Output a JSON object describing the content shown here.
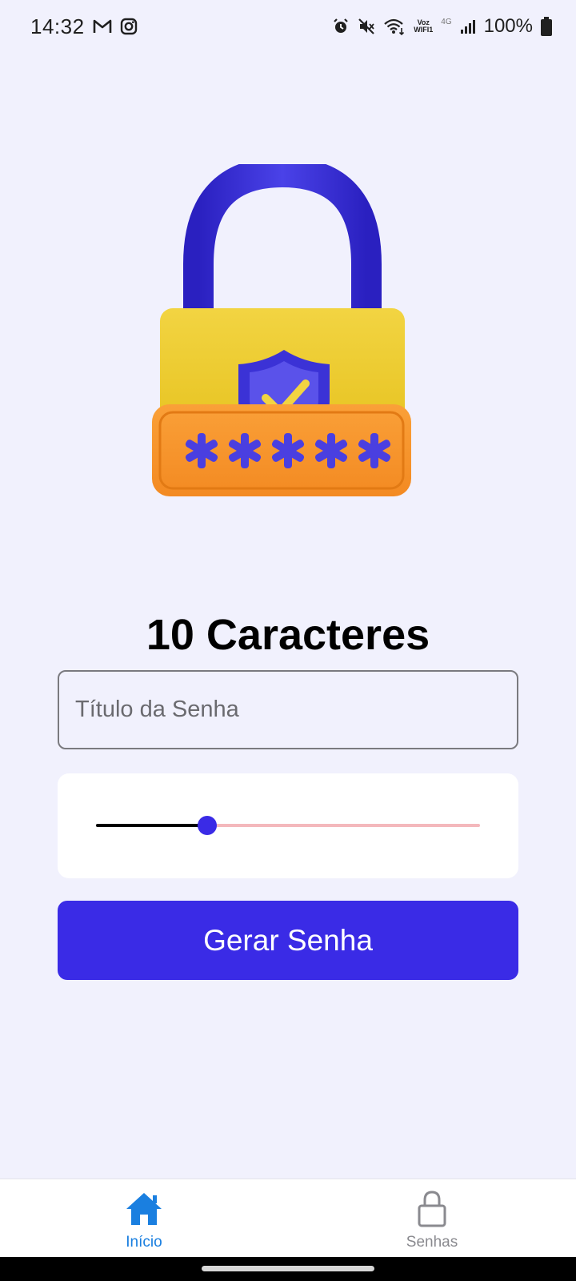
{
  "status_bar": {
    "time": "14:32",
    "battery": "100%",
    "voz_line1": "Voz",
    "voz_line2": "WIFI1",
    "network": "4G",
    "left_icons": [
      "gmail-icon",
      "instagram-icon"
    ],
    "right_icons": [
      "alarm-icon",
      "mute-icon",
      "wifi-icon",
      "signal-icon",
      "battery-icon"
    ]
  },
  "illustration": {
    "icon": "padlock-icon",
    "masked_password": "*****",
    "colors": {
      "shackle": "#3b32d6",
      "body": "#f0d13a",
      "plate": "#f8952f",
      "shield": "#3b32d6"
    }
  },
  "heading": {
    "text": "10 Caracteres"
  },
  "title_field": {
    "placeholder": "Título da Senha",
    "value": ""
  },
  "slider": {
    "fraction": 0.29
  },
  "generate_button": {
    "label": "Gerar Senha"
  },
  "bottom_nav": {
    "tabs": [
      {
        "label": "Início",
        "icon": "home-icon",
        "active": true
      },
      {
        "label": "Senhas",
        "icon": "lock-icon",
        "active": false
      }
    ]
  },
  "colors": {
    "background": "#f1f1fd",
    "accent": "#3a2be6",
    "active_tab": "#1a7fe0",
    "inactive_tab": "#8a8a8f"
  }
}
